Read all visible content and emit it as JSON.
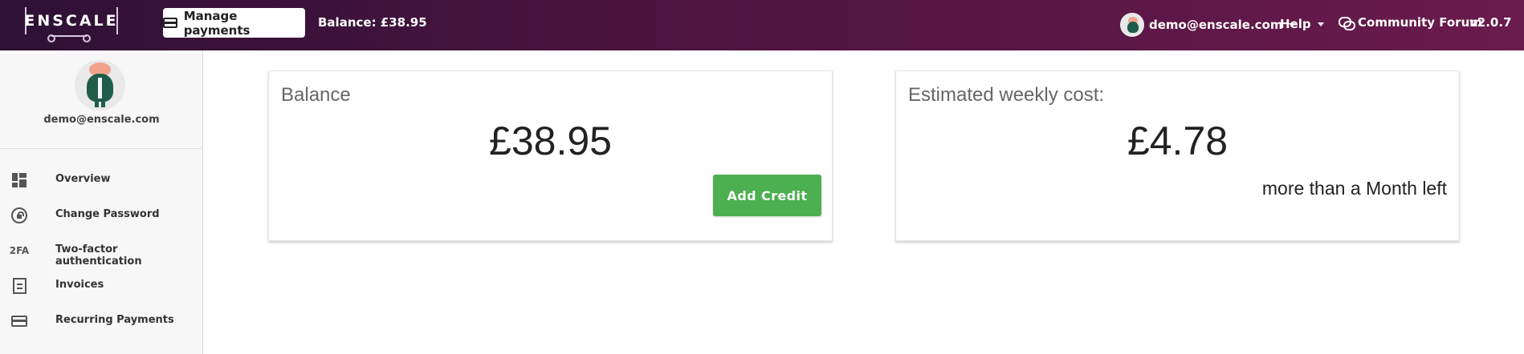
{
  "header": {
    "logo_text": "ENSCALE",
    "manage_payments_label": "Manage payments",
    "balance_text": "Balance: £38.95",
    "user_email": "demo@enscale.com",
    "help_label": "Help",
    "forum_label": "Community Forum",
    "version": "v2.0.7"
  },
  "sidebar": {
    "profile_email": "demo@enscale.com",
    "items": [
      {
        "label": "Overview",
        "icon": "dashboard-icon"
      },
      {
        "label": "Change Password",
        "icon": "lock-reset-icon"
      },
      {
        "label": "Two-factor authentication",
        "icon": "two-factor-icon",
        "icon_text": "2FA"
      },
      {
        "label": "Invoices",
        "icon": "invoice-icon"
      },
      {
        "label": "Recurring Payments",
        "icon": "credit-card-icon"
      }
    ]
  },
  "main": {
    "balance_card": {
      "title": "Balance",
      "value": "£38.95",
      "button_label": "Add Credit"
    },
    "weekly_card": {
      "title": "Estimated weekly cost:",
      "value": "£4.78",
      "subtext": "more than a Month left"
    }
  },
  "colors": {
    "header_start": "#2e1135",
    "header_end": "#6a1b4d",
    "accent_green": "#4caf50",
    "sidebar_bg": "#f7f7f7"
  }
}
